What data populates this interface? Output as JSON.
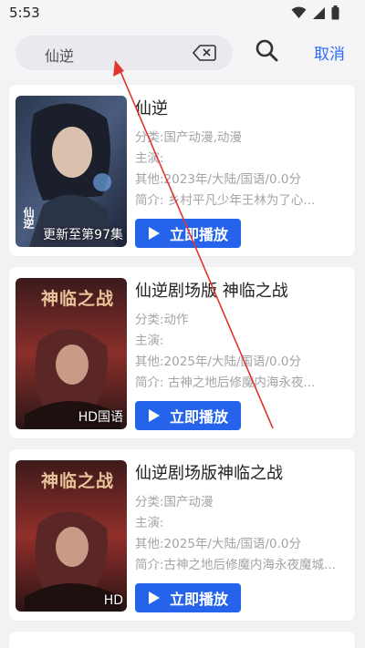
{
  "status": {
    "time": "5:53"
  },
  "search": {
    "query": "仙逆",
    "cancel_label": "取消"
  },
  "results": [
    {
      "title": "仙逆",
      "category": "分类:国产动漫,动漫",
      "cast": "主演:",
      "other": "其他:2023年/大陆/国语/0.0分",
      "intro": "简介:      乡村平凡少年王林为了心...",
      "badge": "更新至第97集",
      "poster_text": "仙逆",
      "play_label": "立即播放"
    },
    {
      "title": "仙逆剧场版 神临之战",
      "category": "分类:动作",
      "cast": "主演:",
      "other": "其他:2025年/大陆/国语/0.0分",
      "intro": "简介:      古神之地后修魔内海永夜...",
      "badge": "HD国语",
      "poster_text": "神临之战",
      "play_label": "立即播放"
    },
    {
      "title": "仙逆剧场版神临之战",
      "category": "分类:国产动漫",
      "cast": "主演:",
      "other": "其他:2025年/大陆/国语/0.0分",
      "intro": "简介:古神之地后修魔内海永夜魔城...",
      "badge": "HD",
      "poster_text": "神临之战",
      "play_label": "立即播放"
    }
  ],
  "colors": {
    "accent": "#2563eb",
    "cancel": "#2d6df6",
    "annotation_arrow": "#e0362f"
  }
}
